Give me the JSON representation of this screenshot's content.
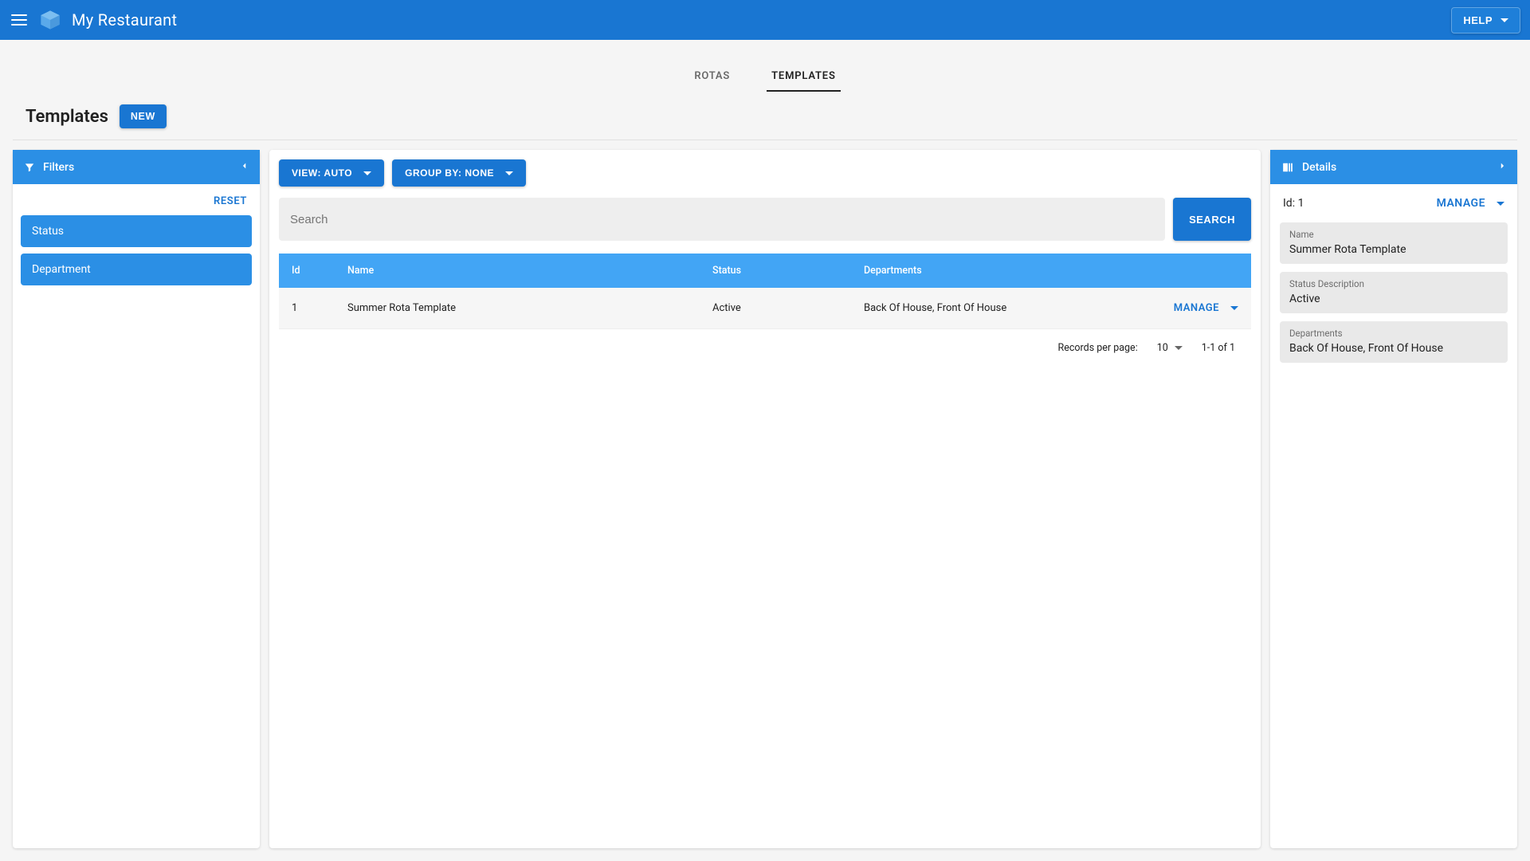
{
  "appbar": {
    "title": "My Restaurant",
    "help_label": "HELP"
  },
  "tabs": {
    "rotas": "ROTAS",
    "templates": "TEMPLATES"
  },
  "page": {
    "title": "Templates",
    "new_label": "NEW"
  },
  "filters": {
    "header": "Filters",
    "reset": "RESET",
    "items": [
      "Status",
      "Department"
    ]
  },
  "toolbar": {
    "view_label": "VIEW: AUTO",
    "group_label": "GROUP BY: NONE"
  },
  "search": {
    "placeholder": "Search",
    "button": "SEARCH"
  },
  "table": {
    "headers": {
      "id": "Id",
      "name": "Name",
      "status": "Status",
      "departments": "Departments"
    },
    "manage_label": "MANAGE",
    "rows": [
      {
        "id": "1",
        "name": "Summer Rota Template",
        "status": "Active",
        "departments": "Back Of House, Front Of House"
      }
    ]
  },
  "pagination": {
    "records_label": "Records per page:",
    "per_page": "10",
    "range": "1-1 of 1"
  },
  "details": {
    "header": "Details",
    "id_label": "Id: 1",
    "manage_label": "MANAGE",
    "cards": {
      "name_label": "Name",
      "name_value": "Summer Rota Template",
      "status_label": "Status Description",
      "status_value": "Active",
      "dept_label": "Departments",
      "dept_value": "Back Of House, Front Of House"
    }
  }
}
